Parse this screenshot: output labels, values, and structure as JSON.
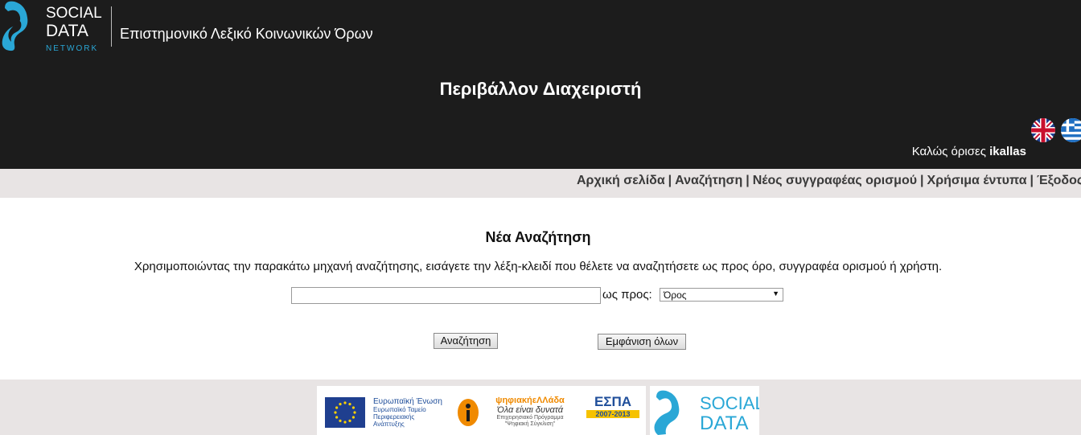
{
  "header": {
    "logo": {
      "line1": "SOCIAL",
      "line2": "DATA",
      "line3": "NETWORK"
    },
    "site_title": "Επιστημονικό Λεξικό  Κοινωνικών Όρων",
    "admin_title": "Περιβάλλον Διαχειριστή",
    "languages": [
      "english-flag",
      "greek-flag"
    ],
    "welcome_text": "Καλώς όρισες ",
    "username": "ikallas"
  },
  "nav": {
    "items": [
      {
        "label": "Αρχική σελίδα"
      },
      {
        "label": "Αναζήτηση"
      },
      {
        "label": "Νέος συγγραφέας ορισμού"
      },
      {
        "label": "Χρήσιμα έντυπα"
      },
      {
        "label": "Έξοδος"
      }
    ]
  },
  "search": {
    "title": "Νέα Αναζήτηση",
    "instructions": "Χρησιμοποιώντας την παρακάτω μηχανή αναζήτησης, εισάγετε την λέξη-κλειδί που θέλετε να αναζητήσετε ως προς όρο, συγγραφέα ορισμού ή χρήστη.",
    "input_value": "",
    "by_label": "ως προς:",
    "selected_option": "Όρος",
    "search_button": "Αναζήτηση",
    "show_all_button": "Εμφάνιση όλων"
  },
  "footer": {
    "eu_label": "Ευρωπαϊκή Ένωση",
    "eu_fund": "Ευρωπαϊκό Ταμείο Περιφερειακής Ανάπτυξης",
    "digital_greece": "ψηφιακήεΛΛάδα",
    "digital_slogan": "Όλα είναι δυνατά",
    "digital_program": "Επιχειρησιακό Πρόγραμμα \"Ψηφιακή Σύγκλιση\"",
    "espa_label": "ΕΣΠΑ",
    "espa_years": "2007-2013",
    "sdn_line1": "SOCIAL",
    "sdn_line2": "DATA",
    "colors": {
      "header_bg": "#1c1c1c",
      "nav_bg": "#e8e4e4",
      "eu_blue": "#1f4e9a",
      "sdn_cyan": "#2aa7d6"
    }
  }
}
